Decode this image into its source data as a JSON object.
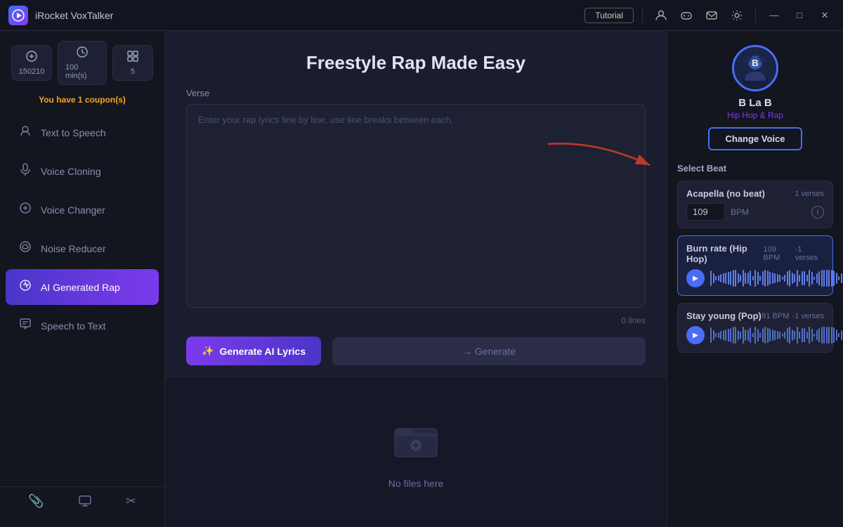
{
  "app": {
    "logo": "🚀",
    "title": "iRocket VoxTalker",
    "tutorial_btn": "Tutorial"
  },
  "titlebar": {
    "icons": [
      "👤",
      "🎮",
      "✉",
      "⚙"
    ],
    "win_buttons": [
      "—",
      "□",
      "✕"
    ]
  },
  "sidebar": {
    "stats": [
      {
        "icon": "⏱",
        "value": "150210"
      },
      {
        "icon": "⏰",
        "value": "100 min(s)"
      },
      {
        "icon": "🔲",
        "value": "5"
      }
    ],
    "coupon": "You have 1 coupon(s)",
    "nav_items": [
      {
        "id": "text-to-speech",
        "icon": "🔊",
        "label": "Text to Speech",
        "active": false
      },
      {
        "id": "voice-cloning",
        "icon": "🎙",
        "label": "Voice Cloning",
        "active": false
      },
      {
        "id": "voice-changer",
        "icon": "🎛",
        "label": "Voice Changer",
        "active": false
      },
      {
        "id": "noise-reducer",
        "icon": "🎧",
        "label": "Noise Reducer",
        "active": false
      },
      {
        "id": "ai-generated-rap",
        "icon": "🎤",
        "label": "AI Generated Rap",
        "active": true
      },
      {
        "id": "speech-to-text",
        "icon": "📝",
        "label": "Speech to Text",
        "active": false
      }
    ],
    "bottom_icons": [
      "📎",
      "⬜",
      "✂"
    ]
  },
  "main": {
    "page_title": "Freestyle Rap Made Easy",
    "verse_label": "Verse",
    "textarea_placeholder": "Enter your rap lyrics line by line, use line breaks between each.",
    "lines_count": "0 lines",
    "generate_lyrics_btn": "Generate AI Lyrics",
    "generate_btn": "→  Generate",
    "no_files_text": "No files here"
  },
  "right_panel": {
    "artist": {
      "avatar_letter": "B",
      "name": "B La B",
      "genre": "Hip Hop & Rap",
      "change_voice_btn": "Change Voice"
    },
    "select_beat_label": "Select Beat",
    "beats": [
      {
        "id": "acapella",
        "name": "Acapella (no beat)",
        "verses": "1 verses",
        "bpm": "109",
        "bpm_label": "BPM",
        "selected": false,
        "has_waveform": false
      },
      {
        "id": "burn-rate",
        "name": "Burn rate (Hip Hop)",
        "verses": "1 verses",
        "bpm_meta": "109 BPM",
        "selected": true,
        "has_waveform": true
      },
      {
        "id": "stay-young",
        "name": "Stay young (Pop)",
        "verses": "1 verses",
        "bpm_meta": "91 BPM",
        "selected": false,
        "has_waveform": true
      }
    ]
  }
}
